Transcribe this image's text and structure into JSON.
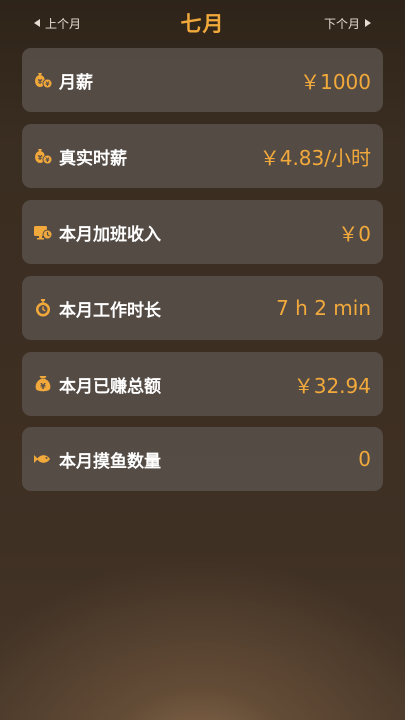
{
  "header": {
    "prev_label": "上个月",
    "title": "七月",
    "next_label": "下个月"
  },
  "accent_color": "#f2a93b",
  "cards": [
    {
      "icon": "money-bag-icon",
      "label": "月薪",
      "value": "￥1000"
    },
    {
      "icon": "money-bag-icon",
      "label": "真实时薪",
      "value": "￥4.83/小时"
    },
    {
      "icon": "overtime-clock-icon",
      "label": "本月加班收入",
      "value": "￥0"
    },
    {
      "icon": "stopwatch-icon",
      "label": "本月工作时长",
      "value": "7 h 2 min"
    },
    {
      "icon": "yuan-bag-icon",
      "label": "本月已赚总额",
      "value": "￥32.94"
    },
    {
      "icon": "fish-icon",
      "label": "本月摸鱼数量",
      "value": "0"
    }
  ]
}
